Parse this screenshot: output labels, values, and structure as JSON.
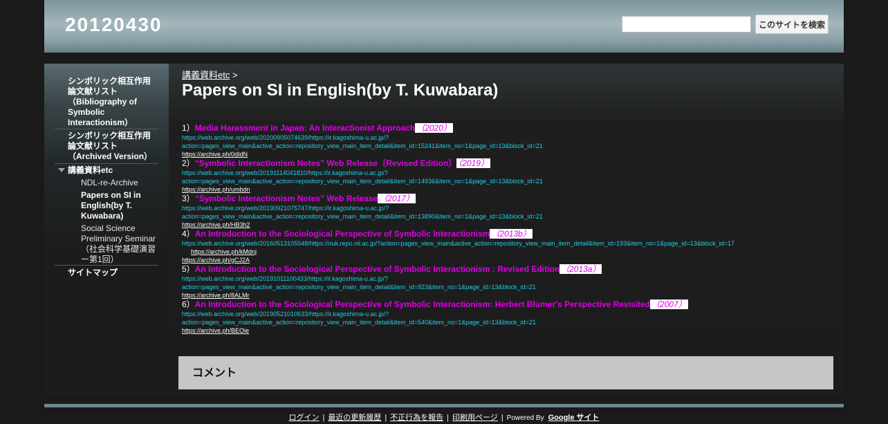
{
  "header": {
    "site_title": "20120430",
    "search_placeholder": "",
    "search_button": "このサイトを検索"
  },
  "sidebar": {
    "items": [
      {
        "label": "シンボリック相互作用論文献リスト（Bibliography of Symbolic Interactionism）"
      },
      {
        "label": "シンボリック相互作用論文献リスト（Archived Version）"
      },
      {
        "label": "講義資料etc"
      },
      {
        "label": "NDL-re-Archive"
      },
      {
        "label": "Papers on SI in English(by T. Kuwabara)"
      },
      {
        "label": "Social Science Preliminary Seminar（社会科学基礎演習ー第1回）"
      },
      {
        "label": "サイトマップ"
      }
    ],
    "icons": {
      "expanded": "triangle-down-icon"
    }
  },
  "main": {
    "breadcrumb_link": "講義資料etc",
    "breadcrumb_sep": " >",
    "title": "Papers on SI in English(by T. Kuwabara)",
    "papers": [
      {
        "num": "1）",
        "title": "Media Harassment in Japan: An Interactionist Approach",
        "year": "（2020）",
        "url1": "https://web.archive.org/web/20200905074639/https://ir.kagoshima-u.ac.jp/?",
        "url2": "action=pages_view_main&active_action=repository_view_main_item_detail&item_id=15241&item_no=1&page_id=13&block_id=21",
        "short": "https://archive.ph/0dIdN"
      },
      {
        "num": "2）",
        "title": "“Symbolic Interactionism Notes” Web Release〔Revised Edition〕",
        "year": "（2019）",
        "url1": "https://web.archive.org/web/20191114041810/https://ir.kagoshima-u.ac.jp/?",
        "url2": "action=pages_view_main&active_action=repository_view_main_item_detail&item_id=14936&item_no=1&page_id=13&block_id=21",
        "short": "https://archive.ph/umbdn"
      },
      {
        "num": "3）",
        "title": "“Symbolic Interactionism Notes” Web Release",
        "year": "（2017）",
        "url1": "https://web.archive.org/web/20190921075747/https://ir.kagoshima-u.ac.jp/?",
        "url2": "action=pages_view_main&active_action=repository_view_main_item_detail&item_id=13890&item_no=1&page_id=13&block_id=21",
        "short": "https://archive.ph/HB3h2"
      },
      {
        "num": "4）",
        "title": "An Introduction to the Sociological Perspective of Symbolic Interactionism",
        "year": "（2013b）",
        "url1": "https://web.archive.org/web/20160513105548/https://nuk.repo.nii.ac.jp/?action=pages_view_main&active_action=repository_view_main_item_detail&item_id=193&item_no=1&page_id=13&block_id=17",
        "short_indented": "https://archive.ph/kMdnj",
        "short": "https://archive.ph/gCJ2A"
      },
      {
        "num": "5）",
        "title": "An Introduction to the Sociological Perspective of Symbolic Interactionism : Revised Edition",
        "year": "（2013a）",
        "url1": "https://web.archive.org/web/20191011100433/https://ir.kagoshima-u.ac.jp/?",
        "url2": "action=pages_view_main&active_action=repository_view_main_item_detail&item_id=923&item_no=1&page_id=13&block_id=21",
        "short": "https://archive.ph/8ALMr"
      },
      {
        "num": "6）",
        "title": "An Introduction to the Sociological Perspective of Symbolic Interactionism: Herbert Blumer's Perspective Revisited",
        "year": "（2007）",
        "url1": "https://web.archive.org/web/20190521010633/https://ir.kagoshima-u.ac.jp/?",
        "url2": "action=pages_view_main&active_action=repository_view_main_item_detail&item_id=540&item_no=1&page_id=13&block_id=21",
        "short": "https://archive.ph/BEOie"
      }
    ]
  },
  "comments": {
    "heading": "コメント"
  },
  "footer": {
    "login": "ログイン",
    "recent": "最近の更新履歴",
    "report": "不正行為を報告",
    "print": "印刷用ページ",
    "pipe": "|",
    "powered_by": "Powered By",
    "google_sites": "Google サイト"
  }
}
